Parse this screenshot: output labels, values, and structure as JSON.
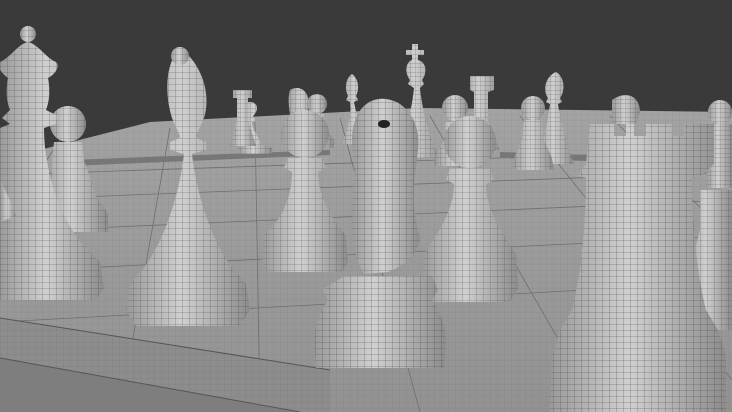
{
  "scene": {
    "subject": "3d-chess-wireframe-render",
    "colors": {
      "background": "#3a3a3a",
      "board": "#9c9c9c",
      "board_edge": "#8a8a8a",
      "piece_light": "#c9c9c9",
      "piece_mid": "#a9a9a9",
      "piece_dark": "#7d7d7d",
      "wire": "#3b3b3b"
    },
    "pieces": [
      "queen",
      "pawn",
      "bishop",
      "pawn",
      "knight",
      "pawn",
      "rook",
      "king",
      "rook",
      "bishop",
      "pawn",
      "knight",
      "pawn",
      "pawn",
      "pawn",
      "knight",
      "rook"
    ]
  }
}
